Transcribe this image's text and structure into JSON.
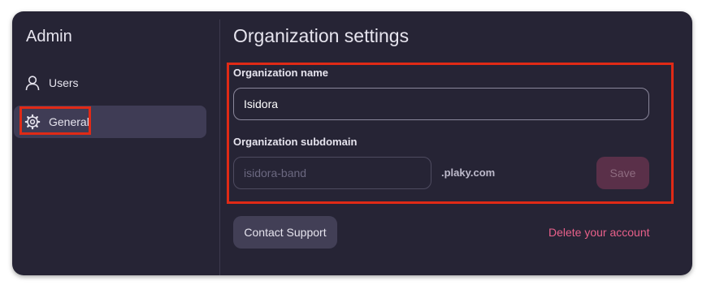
{
  "sidebar": {
    "title": "Admin",
    "items": [
      {
        "label": "Users",
        "icon": "user-icon",
        "active": false
      },
      {
        "label": "General",
        "icon": "gear-icon",
        "active": true
      }
    ]
  },
  "main": {
    "title": "Organization settings",
    "org_name": {
      "label": "Organization name",
      "value": "Isidora"
    },
    "org_subdomain": {
      "label": "Organization subdomain",
      "placeholder": "isidora-band",
      "value": "",
      "suffix": ".plaky.com"
    },
    "save_label": "Save",
    "contact_support_label": "Contact Support",
    "delete_account_label": "Delete your account"
  },
  "colors": {
    "window_bg": "#262435",
    "active_item_bg": "#3f3c55",
    "highlight_border": "#e02a16",
    "danger_link": "#e8608a",
    "save_disabled_bg": "#5a3049"
  }
}
